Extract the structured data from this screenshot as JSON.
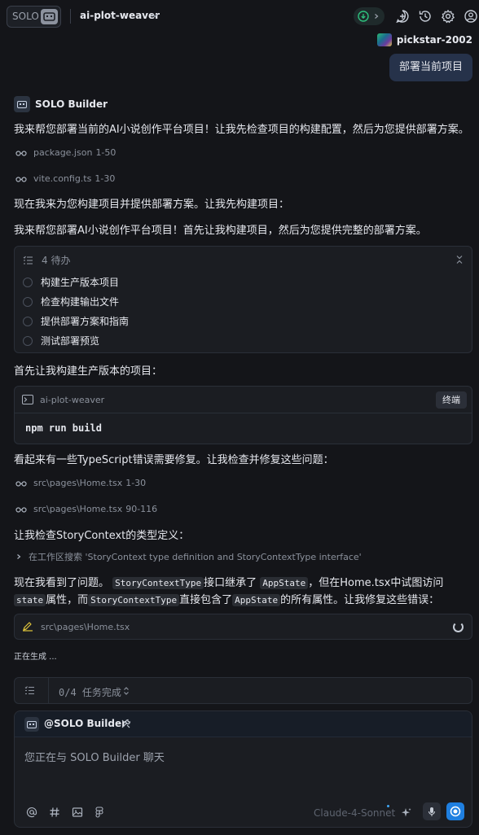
{
  "header": {
    "solo_label": "SOLO",
    "project_name": "ai-plot-weaver"
  },
  "user": {
    "name": "pickstar-2002",
    "message": "部署当前项目"
  },
  "assistant": {
    "name": "SOLO Builder",
    "intro": "我来帮您部署当前的AI小说创作平台项目！让我先检查项目的构建配置，然后为您提供部署方案。",
    "refs_1": [
      {
        "file": "package.json",
        "range": "1-50"
      },
      {
        "file": "vite.config.ts",
        "range": "1-30"
      }
    ],
    "msg_2": "现在我来为您构建项目并提供部署方案。让我先构建项目：",
    "msg_3": "我来帮您部署AI小说创作平台项目！首先让我构建项目，然后为您提供完整的部署方案。",
    "todo": {
      "title": "4 待办",
      "items": [
        "构建生产版本项目",
        "检查构建输出文件",
        "提供部署方案和指南",
        "测试部署预览"
      ]
    },
    "msg_4": "首先让我构建生产版本的项目：",
    "terminal": {
      "name": "ai-plot-weaver",
      "button": "终端",
      "command": "npm run build"
    },
    "msg_5": "看起来有一些TypeScript错误需要修复。让我检查并修复这些问题：",
    "refs_2": [
      {
        "file": "src\\pages\\Home.tsx",
        "range": "1-30"
      },
      {
        "file": "src\\pages\\Home.tsx",
        "range": "90-116"
      }
    ],
    "msg_6": "让我检查StoryContext的类型定义：",
    "search_text": "在工作区搜索 'StoryContext type definition and StoryContextType interface'",
    "msg_7": {
      "t1": "现在我看到了问题。",
      "c1": "StoryContextType",
      "t2": "接口继承了",
      "c2": "AppState",
      "t3": "，但在Home.tsx中试图访问",
      "c3": "state",
      "t4": "属性，而",
      "c4": "StoryContextType",
      "t5": "直接包含了",
      "c5": "AppState",
      "t6": "的所有属性。让我修复这些错误："
    },
    "edit_file": "src\\pages\\Home.tsx",
    "generating": "正在生成 ..."
  },
  "taskbar": {
    "progress_text": "0/4 任务完成"
  },
  "input": {
    "mention": "@SOLO Builder",
    "placeholder": "您正在与 SOLO Builder 聊天",
    "model": "Claude-4-Sonnet"
  },
  "colors": {
    "background": "#141519",
    "card": "#1b1d22",
    "border": "#2a2f38",
    "user_bubble": "#26324a",
    "accent_blue": "#1f7fe0",
    "status_green": "#2ec27e"
  }
}
